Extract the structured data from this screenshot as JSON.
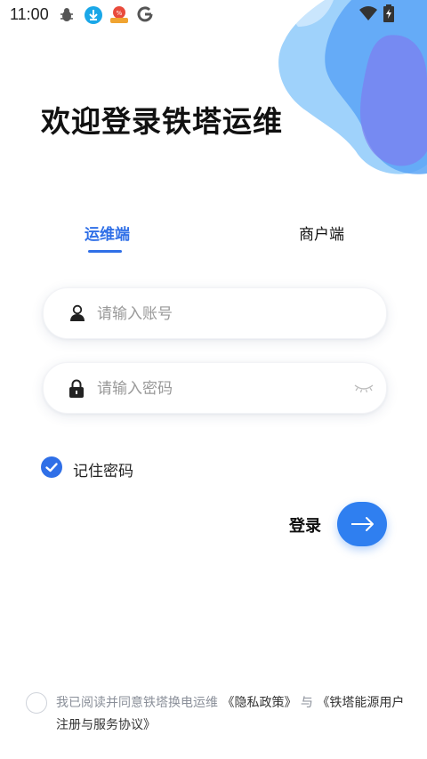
{
  "status_bar": {
    "time": "11:00",
    "icons": [
      "debug-icon",
      "download-icon",
      "app-notification-icon",
      "google-icon",
      "wifi-icon",
      "battery-charging-icon"
    ]
  },
  "colors": {
    "accent": "#2f6fe7",
    "button": "#2f7ff0",
    "blob_light": "#9fd2fb",
    "blob_mid": "#5aa4f6",
    "blob_purple": "#7d7cf0"
  },
  "header": {
    "title": "欢迎登录铁塔运维"
  },
  "tabs": [
    {
      "label": "运维端",
      "active": true
    },
    {
      "label": "商户端",
      "active": false
    }
  ],
  "form": {
    "account": {
      "placeholder": "请输入账号",
      "value": ""
    },
    "password": {
      "placeholder": "请输入密码",
      "value": ""
    },
    "remember": {
      "label": "记住密码",
      "checked": true
    },
    "login_label": "登录"
  },
  "agreement": {
    "checked": false,
    "prefix": "我已阅读并同意铁塔换电运维",
    "privacy_link": "《隐私政策》",
    "and": "与",
    "service_link": "《铁塔能源用户注册与服务协议》"
  }
}
